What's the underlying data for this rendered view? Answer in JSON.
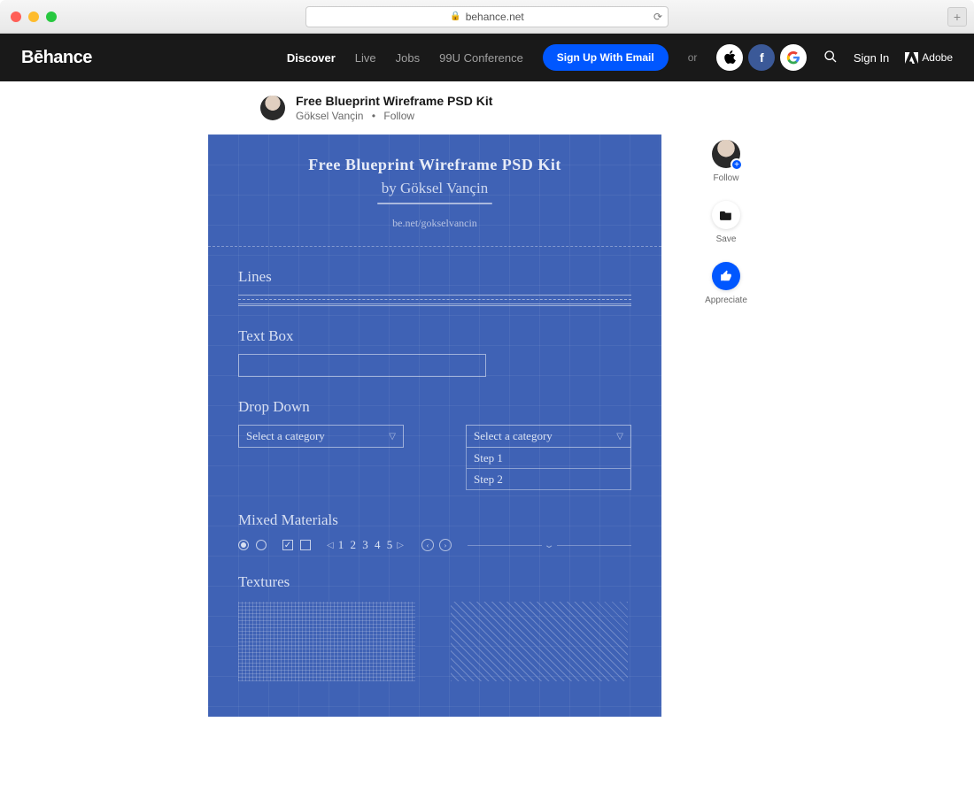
{
  "browser": {
    "url": "behance.net"
  },
  "header": {
    "logo": "Bēhance",
    "nav": {
      "discover": "Discover",
      "live": "Live",
      "jobs": "Jobs",
      "conf": "99U Conference"
    },
    "signup": "Sign Up With Email",
    "or": "or",
    "signin": "Sign In",
    "adobe": "Adobe"
  },
  "project": {
    "title": "Free Blueprint Wireframe PSD Kit",
    "author": "Göksel Vançin",
    "follow": "Follow"
  },
  "sidebar": {
    "follow": "Follow",
    "save": "Save",
    "appreciate": "Appreciate"
  },
  "blueprint": {
    "title": "Free Blueprint Wireframe PSD Kit",
    "byline": "by Göksel Vançin",
    "url": "be.net/gokselvancin",
    "sections": {
      "lines": "Lines",
      "textbox": "Text Box",
      "dropdown": "Drop Down",
      "dd_placeholder": "Select a category",
      "dd_step1": "Step 1",
      "dd_step2": "Step 2",
      "mixed": "Mixed Materials",
      "pager": "1 2 3 4 5",
      "textures": "Textures"
    }
  }
}
